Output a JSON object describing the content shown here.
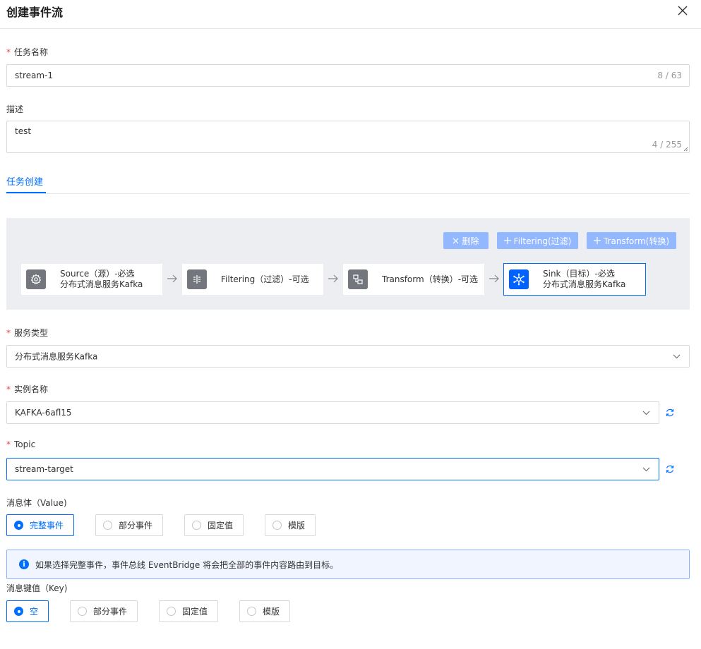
{
  "header": {
    "title": "创建事件流"
  },
  "task_name": {
    "label": "任务名称",
    "required_mark": "*",
    "value": "stream-1",
    "counter": "8 / 63"
  },
  "description": {
    "label": "描述",
    "value": "test",
    "counter": "4 / 255"
  },
  "tabs": [
    {
      "label": "任务创建",
      "active": true
    }
  ],
  "flow": {
    "buttons": {
      "delete": "删除",
      "filtering": "Filtering(过滤)",
      "transform": "Transform(转换)"
    },
    "nodes": [
      {
        "line1": "Source（源）-必选",
        "line2": "分布式消息服务Kafka",
        "icon": "gear-icon"
      },
      {
        "line1": "Filtering（过滤）-可选",
        "line2": "",
        "icon": "filter-icon"
      },
      {
        "line1": "Transform（转换）-可选",
        "line2": "",
        "icon": "transform-icon"
      },
      {
        "line1": "Sink（目标）-必选",
        "line2": "分布式消息服务Kafka",
        "icon": "kafka-icon",
        "active": true
      }
    ]
  },
  "service_type": {
    "label": "服务类型",
    "value": "分布式消息服务Kafka"
  },
  "instance": {
    "label": "实例名称",
    "value": "KAFKA-6afl15"
  },
  "topic": {
    "label": "Topic",
    "value": "stream-target"
  },
  "message_body": {
    "label": "消息体（Value)",
    "options": [
      "完整事件",
      "部分事件",
      "固定值",
      "模版"
    ],
    "selected": "完整事件"
  },
  "info": {
    "text": "如果选择完整事件，事件总线 EventBridge 将会把全部的事件内容路由到目标。"
  },
  "message_key": {
    "label": "消息键值（Key)",
    "options": [
      "空",
      "部分事件",
      "固定值",
      "模版"
    ],
    "selected": "空"
  },
  "colors": {
    "accent": "#006eff",
    "required": "#e54545",
    "panel_bg": "#eceef1",
    "button_light": "#94b8ff"
  }
}
